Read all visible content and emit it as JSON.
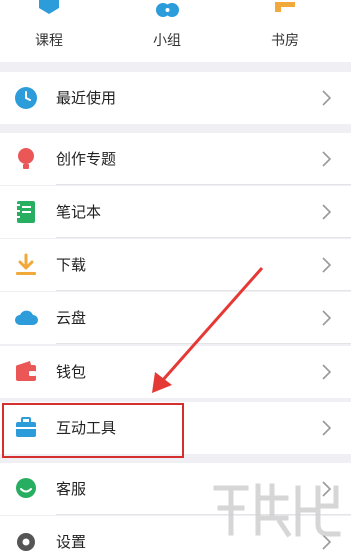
{
  "nav": {
    "items": [
      {
        "label": "课程",
        "icon": "course-icon"
      },
      {
        "label": "小组",
        "icon": "group-icon"
      },
      {
        "label": "书房",
        "icon": "study-room-icon"
      }
    ]
  },
  "menu": {
    "recent": "最近使用",
    "items": [
      {
        "label": "创作专题",
        "icon": "bulb-icon"
      },
      {
        "label": "笔记本",
        "icon": "notebook-icon"
      },
      {
        "label": "下载",
        "icon": "download-icon"
      },
      {
        "label": "云盘",
        "icon": "cloud-icon"
      },
      {
        "label": "钱包",
        "icon": "wallet-icon"
      },
      {
        "label": "互动工具",
        "icon": "toolbox-icon"
      },
      {
        "label": "客服",
        "icon": "support-icon"
      },
      {
        "label": "设置",
        "icon": "settings-icon"
      }
    ]
  },
  "colors": {
    "highlight": "#d32f2f",
    "icon_blue": "#2d9cdb",
    "icon_green": "#27ae60",
    "icon_orange": "#f2a93b",
    "icon_red": "#eb5757"
  }
}
